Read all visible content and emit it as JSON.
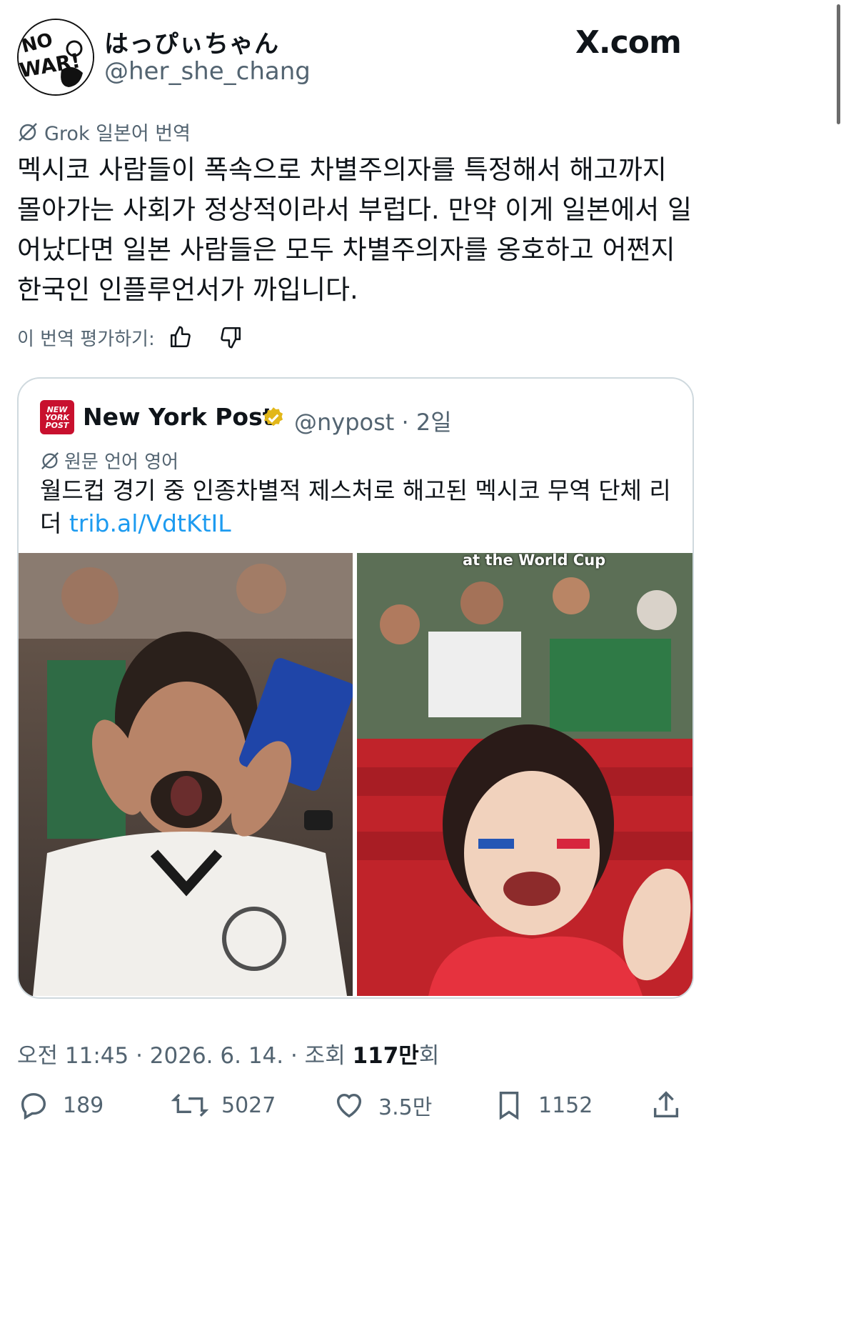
{
  "author": {
    "display_name": "はっぴぃちゃん",
    "handle": "@her_she_chang",
    "avatar_text": "NO WAR!"
  },
  "brand": {
    "logo_text": "X.com"
  },
  "translation": {
    "label": "Grok 일본어 번역",
    "body": "멕시코 사람들이 폭속으로 차별주의자를 특정해서 해고까지\n몰아가는 사회가 정상적이라서 부럽다. 만약 이게 일본에서 일\n어났다면 일본 사람들은 모두 차별주의자를 옹호하고 어쩐지\n한국인 인플루언서가 까입니다.",
    "rate_label": "이 번역 평가하기:"
  },
  "quote": {
    "logo_text": "NEW YORK POST",
    "name": "New York Post",
    "handle_time": "@nypost · 2일",
    "original_label": "원문 언어 영어",
    "text": "월드컵 경기 중 인종차별적 제스처로 해고된 멕시코 무역 단체 리\n더 ",
    "link": "trib.al/VdtKtIL",
    "photo_caption": "at the World Cup"
  },
  "meta": {
    "time_date": "오전 11:45 · 2026. 6. 14. · 조회 ",
    "views": "117만",
    "views_suffix": "회"
  },
  "actions": {
    "replies": "189",
    "reposts": "5027",
    "likes": "3.5만",
    "bookmarks": "1152"
  },
  "colors": {
    "accent": "#1d9bf0",
    "muted": "#536471",
    "text": "#0f1419",
    "nypost_red": "#c8102e",
    "verified_gold": "#e2b719"
  }
}
